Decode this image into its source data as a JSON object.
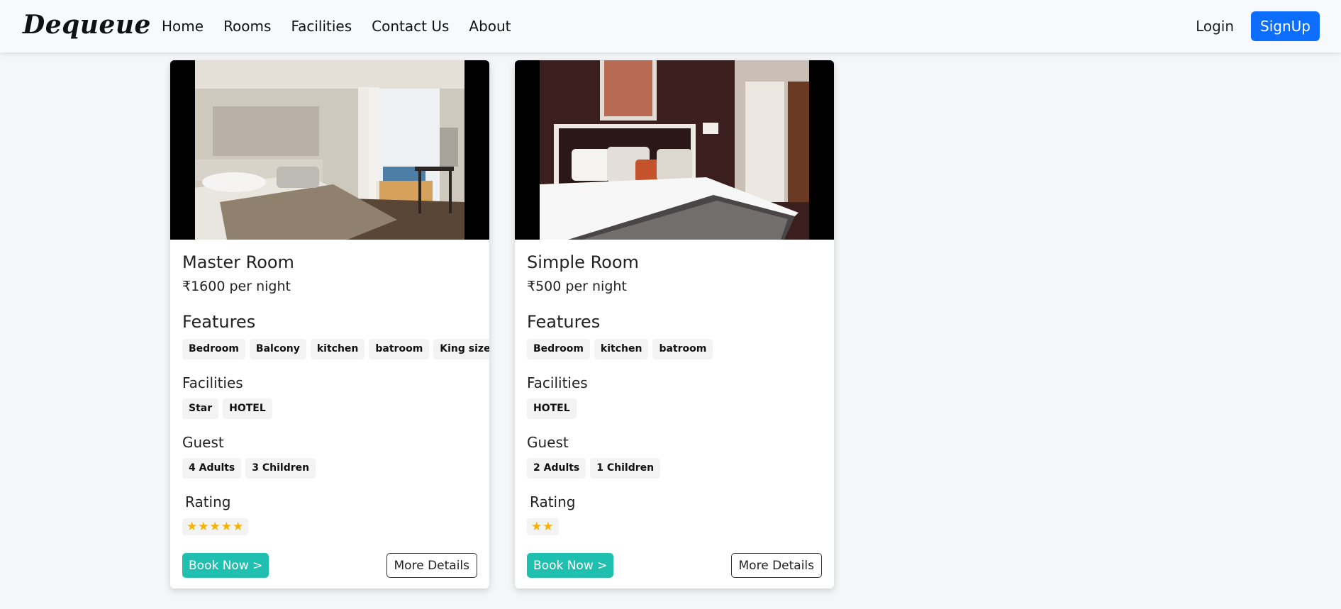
{
  "nav": {
    "brand": "Dequeue",
    "links": [
      "Home",
      "Rooms",
      "Facilities",
      "Contact Us",
      "About"
    ],
    "login": "Login",
    "signup": "SignUp"
  },
  "labels": {
    "features": "Features",
    "facilities": "Facilities",
    "guest": "Guest",
    "rating": "Rating",
    "book_now": "Book Now >",
    "more_details": "More Details"
  },
  "rooms": [
    {
      "name": "Master Room",
      "price": "₹1600 per night",
      "features": [
        "Bedroom",
        "Balcony",
        "kitchen",
        "batroom",
        "King size bed"
      ],
      "facilities": [
        "Star",
        "HOTEL"
      ],
      "guests": [
        "4 Adults",
        "3 Children"
      ],
      "rating": 5
    },
    {
      "name": "Simple Room",
      "price": "₹500 per night",
      "features": [
        "Bedroom",
        "kitchen",
        "batroom"
      ],
      "facilities": [
        "HOTEL"
      ],
      "guests": [
        "2 Adults",
        "1 Children"
      ],
      "rating": 2
    }
  ],
  "colors": {
    "primary": "#0d6efd",
    "book_button": "#20c0b0",
    "star": "#f5b301"
  }
}
